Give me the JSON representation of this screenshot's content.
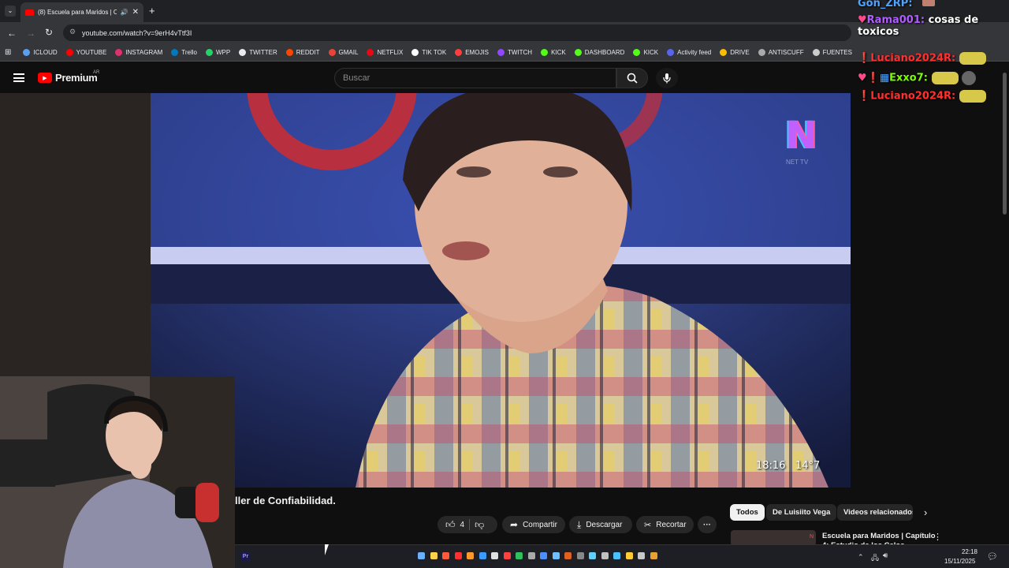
{
  "browser": {
    "tab_title": "(8) Escuela para Maridos | C",
    "url": "youtube.com/watch?v=9erH4vTtf3I",
    "bookmarks": [
      {
        "label": "ICLOUD",
        "color": "#5aa0f0"
      },
      {
        "label": "YOUTUBE",
        "color": "#ff0000"
      },
      {
        "label": "INSTAGRAM",
        "color": "#e1306c"
      },
      {
        "label": "Trello",
        "color": "#0079bf"
      },
      {
        "label": "WPP",
        "color": "#25d366"
      },
      {
        "label": "TWITTER",
        "color": "#e8eaed"
      },
      {
        "label": "REDDIT",
        "color": "#ff4500"
      },
      {
        "label": "GMAIL",
        "color": "#ea4335"
      },
      {
        "label": "NETFLIX",
        "color": "#e50914"
      },
      {
        "label": "TIK TOK",
        "color": "#ffffff"
      },
      {
        "label": "EMOJIS",
        "color": "#ff3d3d"
      },
      {
        "label": "TWITCH",
        "color": "#9146ff"
      },
      {
        "label": "KICK",
        "color": "#53fc18"
      },
      {
        "label": "DASHBOARD",
        "color": "#53fc18"
      },
      {
        "label": "KICK",
        "color": "#53fc18"
      },
      {
        "label": "Activity feed",
        "color": "#5865f2"
      },
      {
        "label": "DRIVE",
        "color": "#fbbc04"
      },
      {
        "label": "ANTISCUFF",
        "color": "#aaaaaa"
      },
      {
        "label": "FUENTES",
        "color": "#cccccc"
      }
    ]
  },
  "youtube": {
    "logo_text": "Premium",
    "region": "AR",
    "search_placeholder": "Buscar",
    "video_title_partial": "ller de Confiabilidad.",
    "likes": "4",
    "share_label": "Compartir",
    "download_label": "Descargar",
    "clip_label": "Recortar",
    "chips": [
      "Todos",
      "De Luisiito Vega",
      "Videos relacionados"
    ],
    "suggested_title_line1": "Escuela para Maridos | Capítulo",
    "suggested_title_line2": "4: Estudio de los Celos"
  },
  "video_overlay": {
    "channel_logo": "N",
    "channel_sub": "NET TV",
    "clock": "18:16",
    "temp": "14°7"
  },
  "chat": [
    {
      "user": "Gon_ZRP:",
      "msg": "",
      "color": "#4fa3ff"
    },
    {
      "user": "Rama001:",
      "msg": "cosas de toxicos",
      "color": "#b05cff"
    },
    {
      "user": "Luciano2024R:",
      "msg": "",
      "color": "#ff3030"
    },
    {
      "user": "Exxo7:",
      "msg": "",
      "color": "#7cfc00"
    },
    {
      "user": "Luciano2024R:",
      "msg": "",
      "color": "#ff3030"
    }
  ],
  "taskbar": {
    "time": "22:18",
    "date": "15/11/2025",
    "premiere_label": "Pr"
  },
  "colors": {
    "accent_red": "#ff0000",
    "chat_bg": "#0f0f0f"
  }
}
